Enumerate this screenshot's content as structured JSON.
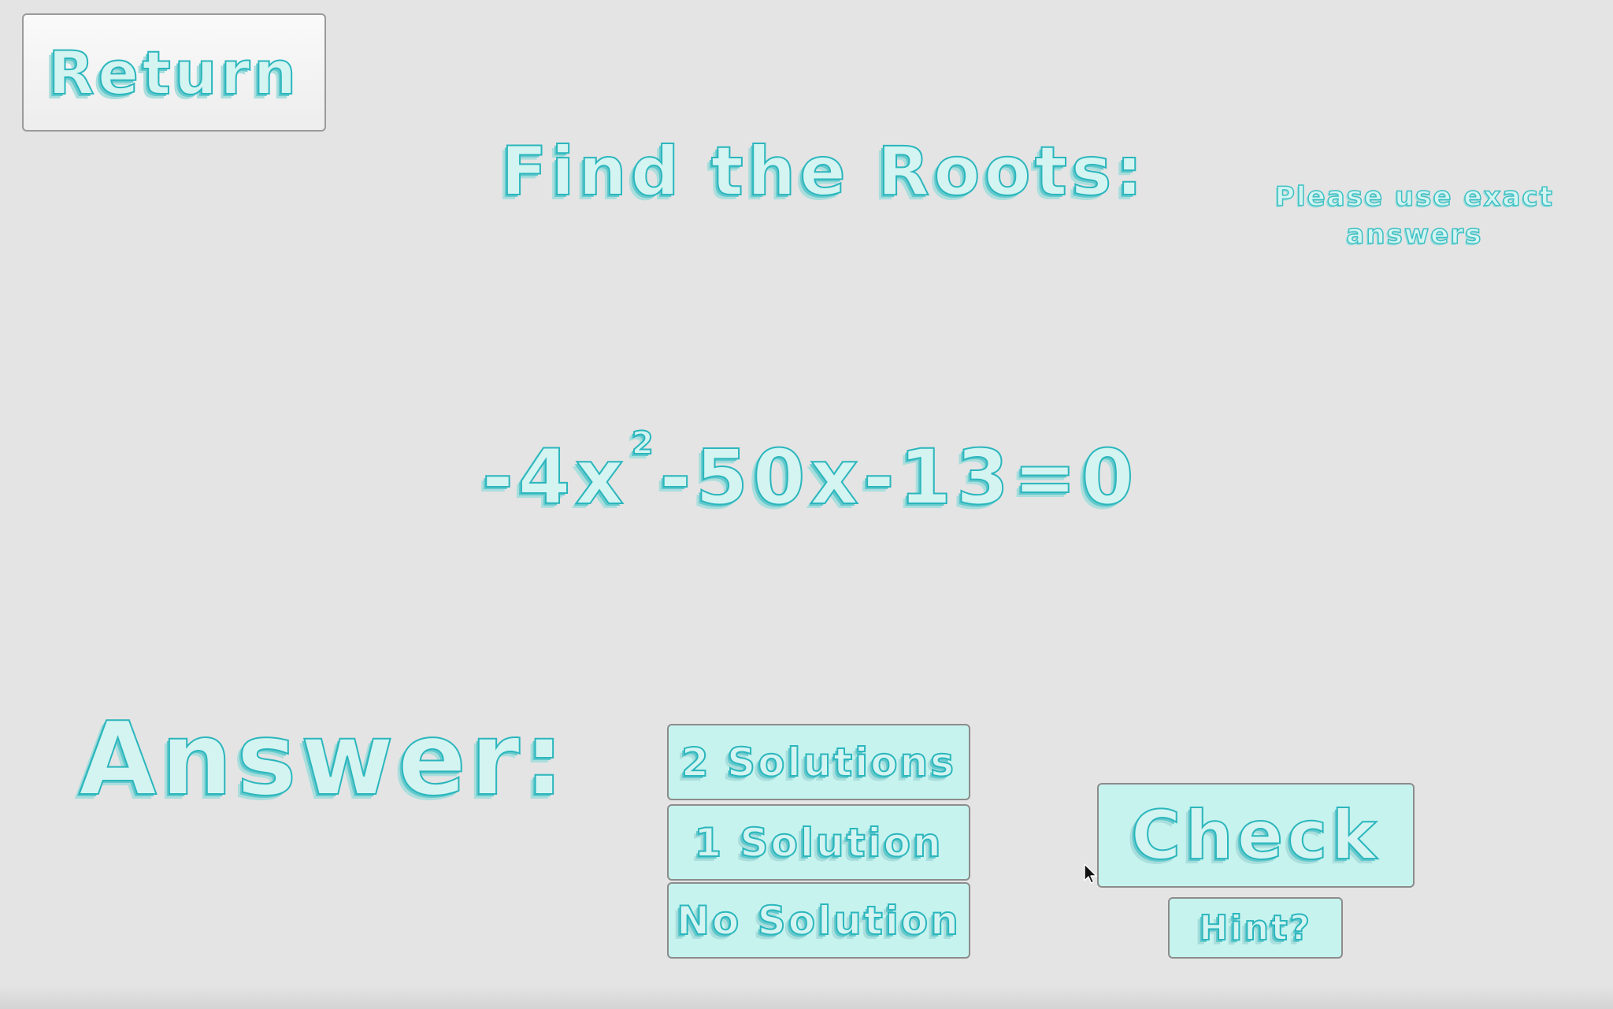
{
  "app": {
    "colors": {
      "background": "#e4e4e4",
      "ink": "#2bb6bd",
      "button_fill": "#c6f3ee",
      "return_fill": "#f5f5f5"
    }
  },
  "nav": {
    "return_label": "Return",
    "return_icon": null
  },
  "problem": {
    "title": "Find the Roots:",
    "note": "Please use exact answers",
    "equation": {
      "lead": "-4x",
      "exponent": "2",
      "rest": "-50x-13=0"
    }
  },
  "answer": {
    "label": "Answer:",
    "options": [
      "2 Solutions",
      "1 Solution",
      "No Solution"
    ]
  },
  "actions": {
    "check_label": "Check",
    "hint_label": "Hint?"
  },
  "pointer": {
    "icon": "mouse-cursor-icon"
  }
}
